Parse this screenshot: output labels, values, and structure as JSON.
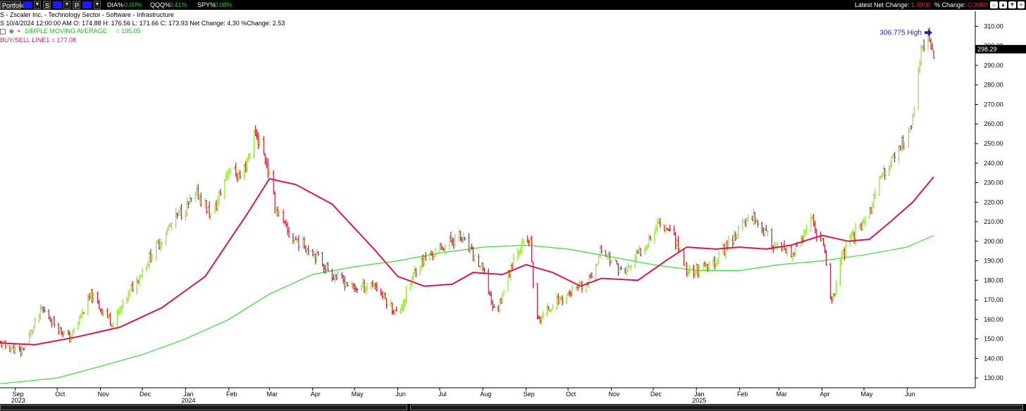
{
  "toolbar": {
    "portfolio_label": "Portfolio",
    "btn_s": "S",
    "btn_p": "P",
    "dia_label": "DIA%",
    "dia_value": "0.00%",
    "qqq_label": "QQQ%",
    "qqq_value": "0.41%",
    "spy_label": "SPY%",
    "spy_value": "0.08%",
    "net_change_label": "Latest Net Change:",
    "net_change_value": "-1.0900",
    "pct_change_label": "% Change:",
    "pct_change_value": "-0.3650"
  },
  "info": {
    "title": "S - Zscaler Inc. - Technology Sector - Software - Infrastructure",
    "ohlc": "S 10/4/2024 12:00:00 AM O: 174.88 H: 176.56 L: 171.66 C: 173.93 Net Change: 4.30  %Change: 2.53",
    "sma_label": "SIMPLE MOVING AVERAGE",
    "sma_value": "= 195.05",
    "buysell": "BUY/SELL LINE1 = 177.08"
  },
  "colors": {
    "up_bar": "#8ee62c",
    "down_bar": "#d4163b",
    "sma": "#39dd39",
    "buysell": "#e0144c",
    "annotation": "#1f24c8"
  },
  "chart_data": {
    "type": "bar",
    "subtype": "ohlc",
    "ylim": [
      125,
      317
    ],
    "y_axis_position": "right",
    "yticks": [
      "130.00",
      "140.00",
      "150.00",
      "160.00",
      "170.00",
      "180.00",
      "190.00",
      "200.00",
      "210.00",
      "220.00",
      "230.00",
      "240.00",
      "250.00",
      "260.00",
      "270.00",
      "280.00",
      "290.00",
      "300.00",
      "310.00"
    ],
    "last_price_label": "298.29",
    "last_price": 298.29,
    "annotation": {
      "text": "306.775 High",
      "value": 306.775
    },
    "x_ticks": [
      {
        "month": "Sep",
        "year": "2023"
      },
      {
        "month": "Oct",
        "year": ""
      },
      {
        "month": "Nov",
        "year": ""
      },
      {
        "month": "Dec",
        "year": ""
      },
      {
        "month": "Jan",
        "year": "2024"
      },
      {
        "month": "Feb",
        "year": ""
      },
      {
        "month": "Mar",
        "year": ""
      },
      {
        "month": "Apr",
        "year": ""
      },
      {
        "month": "May",
        "year": ""
      },
      {
        "month": "Jun",
        "year": ""
      },
      {
        "month": "Jul",
        "year": ""
      },
      {
        "month": "Aug",
        "year": ""
      },
      {
        "month": "Sep",
        "year": ""
      },
      {
        "month": "Oct",
        "year": ""
      },
      {
        "month": "Nov",
        "year": ""
      },
      {
        "month": "Dec",
        "year": ""
      },
      {
        "month": "Jan",
        "year": "2025"
      },
      {
        "month": "Feb",
        "year": ""
      },
      {
        "month": "Mar",
        "year": ""
      },
      {
        "month": "Apr",
        "year": ""
      },
      {
        "month": "May",
        "year": ""
      },
      {
        "month": "Jun",
        "year": ""
      }
    ],
    "price_keypoints": [
      {
        "date": "2023-08-20",
        "close": 148
      },
      {
        "date": "2023-09-05",
        "close": 143
      },
      {
        "date": "2023-09-20",
        "close": 165
      },
      {
        "date": "2023-10-10",
        "close": 150
      },
      {
        "date": "2023-10-25",
        "close": 172
      },
      {
        "date": "2023-11-10",
        "close": 158
      },
      {
        "date": "2023-11-25",
        "close": 178
      },
      {
        "date": "2023-12-10",
        "close": 196
      },
      {
        "date": "2023-12-25",
        "close": 212
      },
      {
        "date": "2024-01-10",
        "close": 224
      },
      {
        "date": "2024-01-20",
        "close": 212
      },
      {
        "date": "2024-02-01",
        "close": 238
      },
      {
        "date": "2024-02-10",
        "close": 232
      },
      {
        "date": "2024-02-20",
        "close": 256
      },
      {
        "date": "2024-02-28",
        "close": 240
      },
      {
        "date": "2024-03-05",
        "close": 218
      },
      {
        "date": "2024-03-15",
        "close": 203
      },
      {
        "date": "2024-04-01",
        "close": 195
      },
      {
        "date": "2024-04-15",
        "close": 183
      },
      {
        "date": "2024-05-01",
        "close": 176
      },
      {
        "date": "2024-05-15",
        "close": 178
      },
      {
        "date": "2024-06-01",
        "close": 162
      },
      {
        "date": "2024-06-15",
        "close": 188
      },
      {
        "date": "2024-07-01",
        "close": 196
      },
      {
        "date": "2024-07-15",
        "close": 203
      },
      {
        "date": "2024-08-01",
        "close": 185
      },
      {
        "date": "2024-08-10",
        "close": 162
      },
      {
        "date": "2024-08-25",
        "close": 196
      },
      {
        "date": "2024-09-04",
        "close": 200
      },
      {
        "date": "2024-09-08",
        "close": 158
      },
      {
        "date": "2024-09-20",
        "close": 168
      },
      {
        "date": "2024-10-01",
        "close": 173
      },
      {
        "date": "2024-10-15",
        "close": 178
      },
      {
        "date": "2024-10-25",
        "close": 196
      },
      {
        "date": "2024-11-10",
        "close": 183
      },
      {
        "date": "2024-11-25",
        "close": 198
      },
      {
        "date": "2024-12-05",
        "close": 210
      },
      {
        "date": "2024-12-15",
        "close": 205
      },
      {
        "date": "2024-12-25",
        "close": 185
      },
      {
        "date": "2025-01-10",
        "close": 186
      },
      {
        "date": "2025-01-25",
        "close": 200
      },
      {
        "date": "2025-02-10",
        "close": 214
      },
      {
        "date": "2025-02-25",
        "close": 198
      },
      {
        "date": "2025-03-10",
        "close": 192
      },
      {
        "date": "2025-03-25",
        "close": 210
      },
      {
        "date": "2025-04-03",
        "close": 195
      },
      {
        "date": "2025-04-08",
        "close": 168
      },
      {
        "date": "2025-04-15",
        "close": 192
      },
      {
        "date": "2025-04-25",
        "close": 205
      },
      {
        "date": "2025-05-05",
        "close": 215
      },
      {
        "date": "2025-05-15",
        "close": 235
      },
      {
        "date": "2025-05-28",
        "close": 250
      },
      {
        "date": "2025-06-03",
        "close": 255
      },
      {
        "date": "2025-06-06",
        "close": 270
      },
      {
        "date": "2025-06-12",
        "close": 300
      },
      {
        "date": "2025-06-14",
        "close": 306
      },
      {
        "date": "2025-06-20",
        "close": 298
      }
    ],
    "series": [
      {
        "name": "SIMPLE MOVING AVERAGE",
        "points": [
          {
            "date": "2023-08-20",
            "value": 127
          },
          {
            "date": "2023-10-01",
            "value": 130
          },
          {
            "date": "2023-11-01",
            "value": 136
          },
          {
            "date": "2023-12-01",
            "value": 142
          },
          {
            "date": "2024-01-01",
            "value": 150
          },
          {
            "date": "2024-02-01",
            "value": 160
          },
          {
            "date": "2024-03-01",
            "value": 173
          },
          {
            "date": "2024-04-01",
            "value": 183
          },
          {
            "date": "2024-05-01",
            "value": 187
          },
          {
            "date": "2024-06-01",
            "value": 190
          },
          {
            "date": "2024-07-01",
            "value": 194
          },
          {
            "date": "2024-08-01",
            "value": 197
          },
          {
            "date": "2024-09-01",
            "value": 198
          },
          {
            "date": "2024-10-01",
            "value": 196
          },
          {
            "date": "2024-11-01",
            "value": 192
          },
          {
            "date": "2024-12-01",
            "value": 188
          },
          {
            "date": "2025-01-01",
            "value": 185
          },
          {
            "date": "2025-02-01",
            "value": 185
          },
          {
            "date": "2025-03-01",
            "value": 188
          },
          {
            "date": "2025-04-01",
            "value": 190
          },
          {
            "date": "2025-05-01",
            "value": 193
          },
          {
            "date": "2025-06-01",
            "value": 197
          },
          {
            "date": "2025-06-20",
            "value": 203
          }
        ]
      },
      {
        "name": "BUY/SELL LINE1",
        "points": [
          {
            "date": "2023-08-20",
            "value": 148
          },
          {
            "date": "2023-09-15",
            "value": 147
          },
          {
            "date": "2023-10-15",
            "value": 151
          },
          {
            "date": "2023-11-15",
            "value": 156
          },
          {
            "date": "2023-12-15",
            "value": 166
          },
          {
            "date": "2024-01-15",
            "value": 182
          },
          {
            "date": "2024-02-15",
            "value": 215
          },
          {
            "date": "2024-03-01",
            "value": 232
          },
          {
            "date": "2024-03-20",
            "value": 229
          },
          {
            "date": "2024-04-15",
            "value": 219
          },
          {
            "date": "2024-05-15",
            "value": 196
          },
          {
            "date": "2024-06-01",
            "value": 182
          },
          {
            "date": "2024-06-20",
            "value": 177
          },
          {
            "date": "2024-07-10",
            "value": 178
          },
          {
            "date": "2024-07-25",
            "value": 184
          },
          {
            "date": "2024-08-15",
            "value": 183
          },
          {
            "date": "2024-09-01",
            "value": 188
          },
          {
            "date": "2024-09-20",
            "value": 184
          },
          {
            "date": "2024-10-10",
            "value": 177
          },
          {
            "date": "2024-10-25",
            "value": 181
          },
          {
            "date": "2024-11-20",
            "value": 180
          },
          {
            "date": "2024-12-10",
            "value": 190
          },
          {
            "date": "2024-12-25",
            "value": 197
          },
          {
            "date": "2025-01-15",
            "value": 196
          },
          {
            "date": "2025-02-01",
            "value": 197
          },
          {
            "date": "2025-02-20",
            "value": 196
          },
          {
            "date": "2025-03-10",
            "value": 198
          },
          {
            "date": "2025-04-01",
            "value": 203
          },
          {
            "date": "2025-04-20",
            "value": 200
          },
          {
            "date": "2025-05-05",
            "value": 201
          },
          {
            "date": "2025-05-20",
            "value": 210
          },
          {
            "date": "2025-06-05",
            "value": 220
          },
          {
            "date": "2025-06-20",
            "value": 233
          }
        ]
      }
    ]
  }
}
